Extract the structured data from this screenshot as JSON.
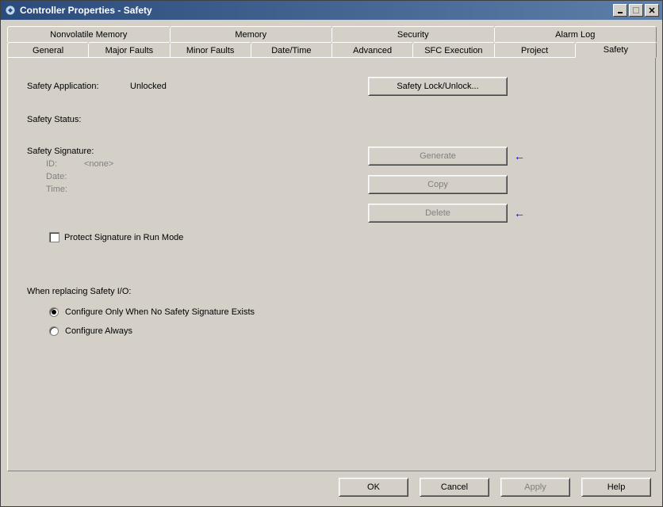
{
  "window": {
    "title": "Controller Properties - Safety"
  },
  "tabs": {
    "upper": [
      "Nonvolatile Memory",
      "Memory",
      "Security",
      "Alarm Log"
    ],
    "lower": [
      "General",
      "Major Faults",
      "Minor Faults",
      "Date/Time",
      "Advanced",
      "SFC Execution",
      "Project",
      "Safety"
    ],
    "active": "Safety"
  },
  "safety": {
    "application_label": "Safety Application:",
    "application_value": "Unlocked",
    "lock_button": "Safety Lock/Unlock...",
    "status_label": "Safety Status:",
    "signature_label": "Safety Signature:",
    "generate_button": "Generate",
    "copy_button": "Copy",
    "delete_button": "Delete",
    "id_label": "ID:",
    "id_value": "<none>",
    "date_label": "Date:",
    "time_label": "Time:",
    "protect_checkbox": "Protect Signature in Run Mode",
    "replace_label": "When replacing Safety I/O:",
    "radio_only": "Configure Only When No Safety Signature Exists",
    "radio_always": "Configure Always"
  },
  "buttons": {
    "ok": "OK",
    "cancel": "Cancel",
    "apply": "Apply",
    "help": "Help"
  }
}
